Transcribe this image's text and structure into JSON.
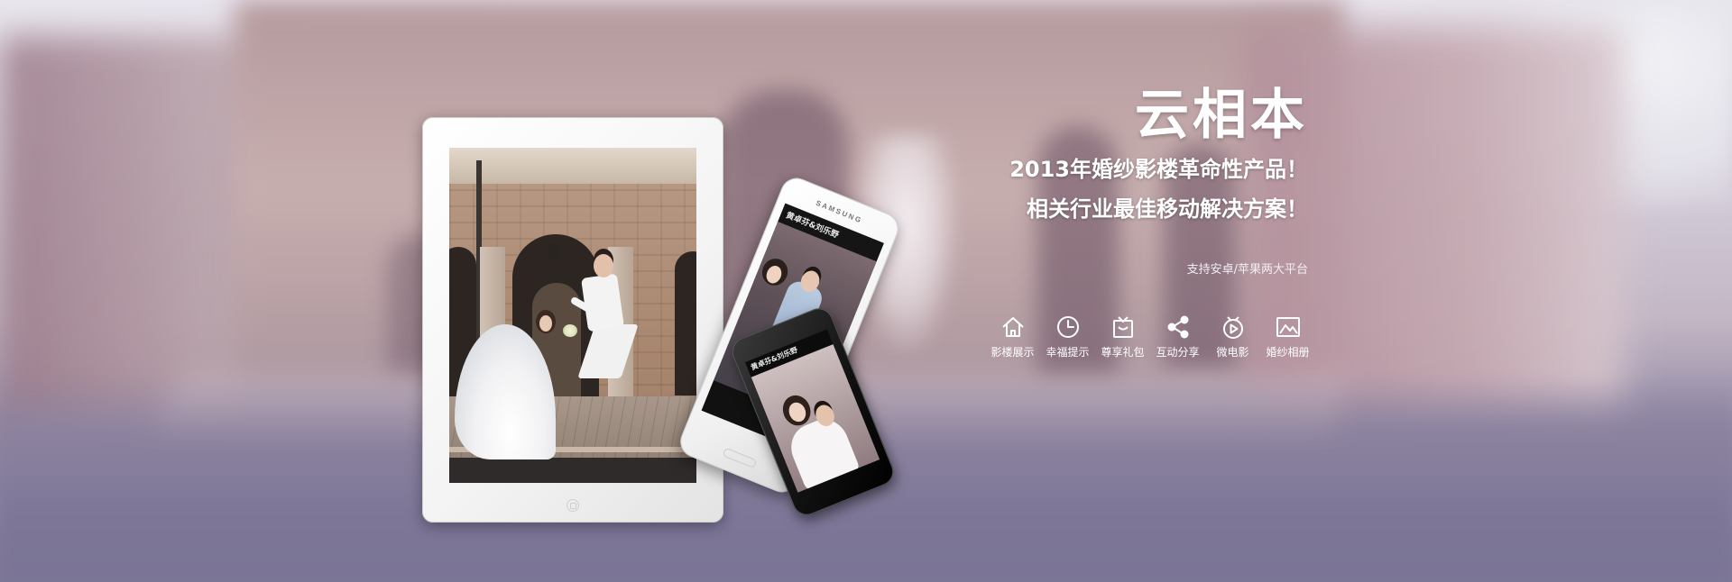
{
  "banner": {
    "title": "云相本",
    "slogan_line1": "2013年婚纱影楼革命性产品！",
    "slogan_line2": "相关行业最佳移动解决方案！",
    "platform_note": "支持安卓/苹果两大平台"
  },
  "features": [
    {
      "label": "影楼展示",
      "icon": "home-icon"
    },
    {
      "label": "幸福提示",
      "icon": "clock-icon"
    },
    {
      "label": "尊享礼包",
      "icon": "gift-icon"
    },
    {
      "label": "互动分享",
      "icon": "share-icon"
    },
    {
      "label": "微电影",
      "icon": "video-icon"
    },
    {
      "label": "婚纱相册",
      "icon": "image-icon"
    }
  ],
  "devices": {
    "phone_white_brand": "SAMSUNG",
    "phone_white_app_title": "黄卓芬&刘乐野",
    "phone_black_app_title": "黄卓芬&刘乐野"
  },
  "colors": {
    "text": "#ffffff",
    "background_tint": "#8c7f95"
  }
}
